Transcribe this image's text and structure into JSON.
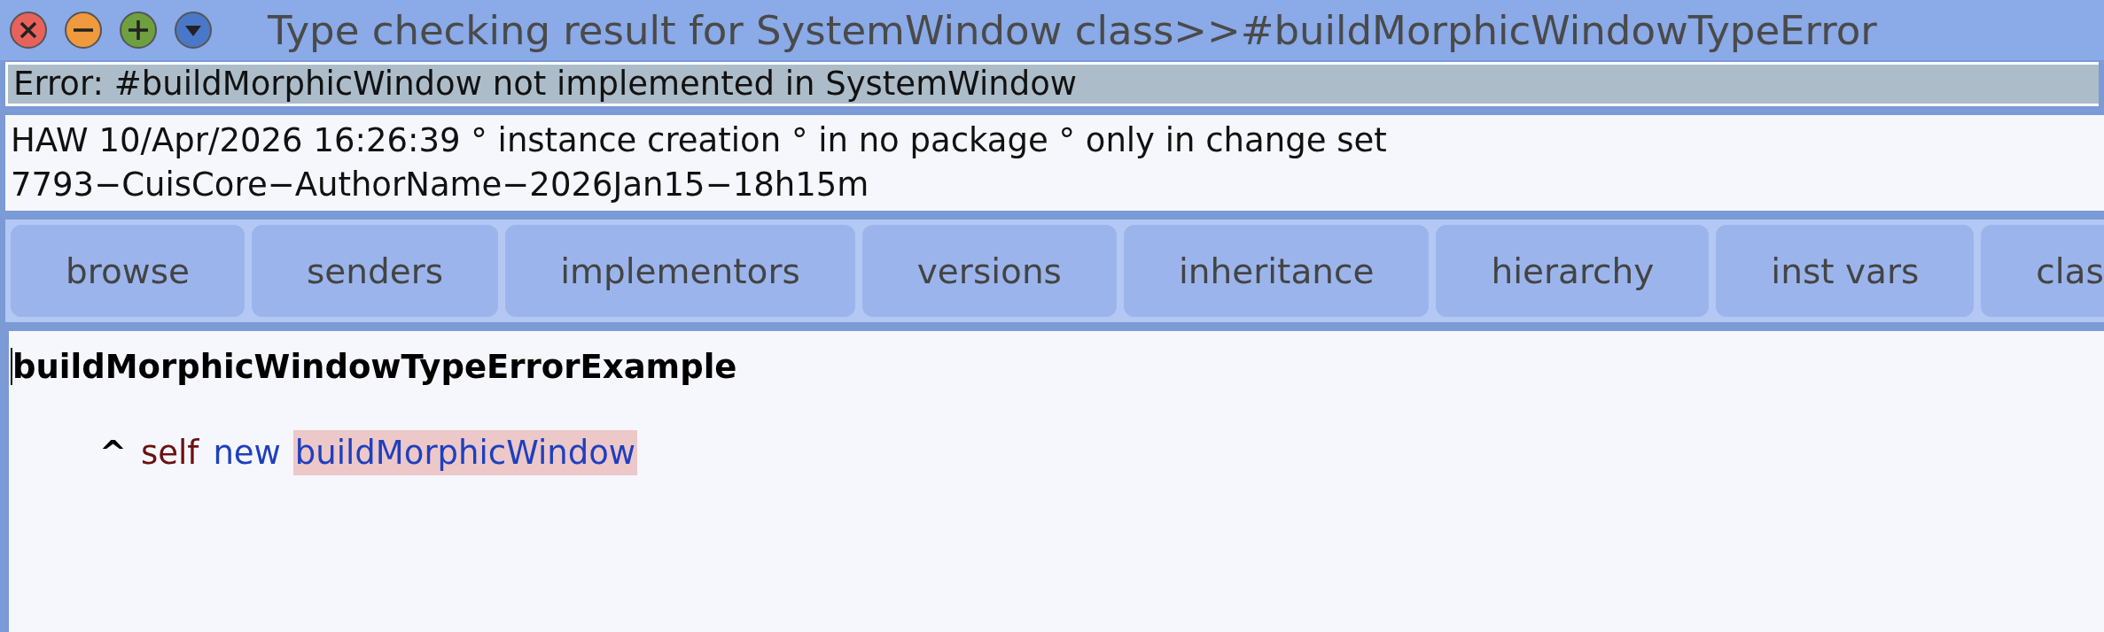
{
  "window": {
    "title": "Type checking result for SystemWindow class>>#buildMorphicWindowTypeError"
  },
  "error": {
    "message": "Error: #buildMorphicWindow not implemented in SystemWindow"
  },
  "info": {
    "lines": [
      "HAW 10/Apr/2026 16:26:39 ° instance creation ° in no package ° only in change set",
      "7793−CuisCore−AuthorName−2026Jan15−18h15m"
    ]
  },
  "buttons": [
    {
      "label": "browse"
    },
    {
      "label": "senders"
    },
    {
      "label": "implementors"
    },
    {
      "label": "versions"
    },
    {
      "label": "inheritance"
    },
    {
      "label": "hierarchy"
    },
    {
      "label": "inst vars"
    },
    {
      "label": "clas"
    }
  ],
  "code": {
    "selector": "buildMorphicWindowTypeErrorExample",
    "tokens": [
      {
        "text": "^",
        "kind": "return",
        "highlighted": false
      },
      {
        "text": "self",
        "kind": "pseudo",
        "highlighted": false
      },
      {
        "text": "new",
        "kind": "message",
        "highlighted": false
      },
      {
        "text": "buildMorphicWindow",
        "kind": "message",
        "highlighted": true
      }
    ]
  }
}
